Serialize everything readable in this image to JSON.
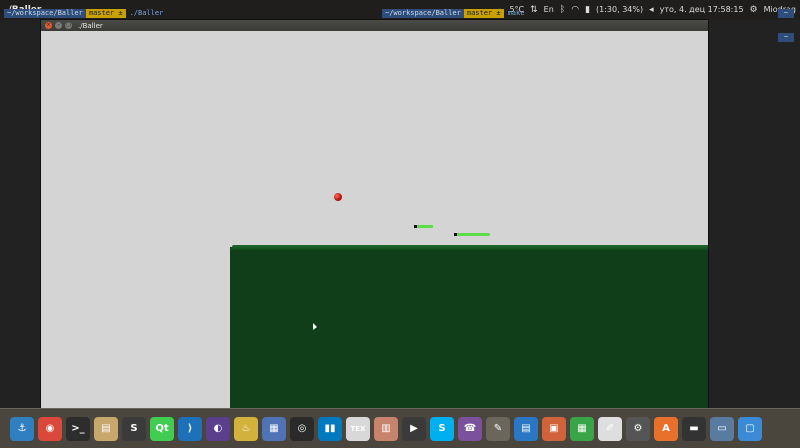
{
  "top_panel": {
    "window_title": "./Baller",
    "tray": {
      "temperature": "5°C",
      "keyboard_layout": "En",
      "battery": "(1:30, 34%)",
      "clock": "уто, 4. дец 17:58:15",
      "user": "Miodrag"
    }
  },
  "terminal": {
    "left_prompt": {
      "path": "~/workspace/Baller",
      "git": "master ±",
      "command": "./Baller"
    },
    "right_prompt": {
      "path": "~/workspace/Baller",
      "git": "master ±",
      "command": "make"
    },
    "side_tag": "~"
  },
  "game_window": {
    "title": "./Baller",
    "buttons": {
      "close": "×",
      "minimize": "–",
      "maximize": "□"
    }
  },
  "colors": {
    "sky": "#d4d4d4",
    "ground": "#0f3e18",
    "ball": "#b3140c",
    "platform": "#5ddc4a",
    "dock": "#4a463e"
  },
  "dock": {
    "apps": [
      {
        "name": "anchor-app-icon",
        "glyph": "⚓",
        "color": "#2f7fc1"
      },
      {
        "name": "chrome-icon",
        "glyph": "◉",
        "color": "#d9483b"
      },
      {
        "name": "terminal-icon",
        "glyph": ">_",
        "color": "#2d2d2d"
      },
      {
        "name": "files-icon",
        "glyph": "▤",
        "color": "#c7a76c"
      },
      {
        "name": "s-app-icon",
        "glyph": "S",
        "color": "#3a3a3a"
      },
      {
        "name": "qt-creator-icon",
        "glyph": "Qt",
        "color": "#41cd52"
      },
      {
        "name": "vscode-icon",
        "glyph": "⟩",
        "color": "#1e70b8"
      },
      {
        "name": "eclipse-icon",
        "glyph": "◐",
        "color": "#5b3f8c"
      },
      {
        "name": "kettle-app-icon",
        "glyph": "♨",
        "color": "#d2b23c"
      },
      {
        "name": "calendar-app-icon",
        "glyph": "▦",
        "color": "#4f73b5"
      },
      {
        "name": "record-app-icon",
        "glyph": "◎",
        "color": "#2a2a2a"
      },
      {
        "name": "trello-icon",
        "glyph": "▮▮",
        "color": "#0079bf"
      },
      {
        "name": "texmaker-icon",
        "glyph": "TEX",
        "color": "#d8d8d8"
      },
      {
        "name": "archive-icon",
        "glyph": "▥",
        "color": "#c7836c"
      },
      {
        "name": "video-editor-icon",
        "glyph": "▶",
        "color": "#3a3a3a"
      },
      {
        "name": "skype-icon",
        "glyph": "S",
        "color": "#00aff0"
      },
      {
        "name": "viber-icon",
        "glyph": "☎",
        "color": "#7b519d"
      },
      {
        "name": "paint-app-icon",
        "glyph": "✎",
        "color": "#6a665c"
      },
      {
        "name": "writer-icon",
        "glyph": "▤",
        "color": "#2a78c4"
      },
      {
        "name": "impress-icon",
        "glyph": "▣",
        "color": "#d0633a"
      },
      {
        "name": "calc-icon",
        "glyph": "▦",
        "color": "#38a548"
      },
      {
        "name": "text-editor-icon",
        "glyph": "✐",
        "color": "#dedede"
      },
      {
        "name": "settings-icon",
        "glyph": "⚙",
        "color": "#555555"
      },
      {
        "name": "software-center-icon",
        "glyph": "A",
        "color": "#e8702a"
      },
      {
        "name": "disk-icon",
        "glyph": "▬",
        "color": "#333333"
      },
      {
        "name": "window-icon",
        "glyph": "▭",
        "color": "#5a7ba0"
      },
      {
        "name": "workspace-icon",
        "glyph": "▢",
        "color": "#3b8ad6"
      }
    ]
  }
}
